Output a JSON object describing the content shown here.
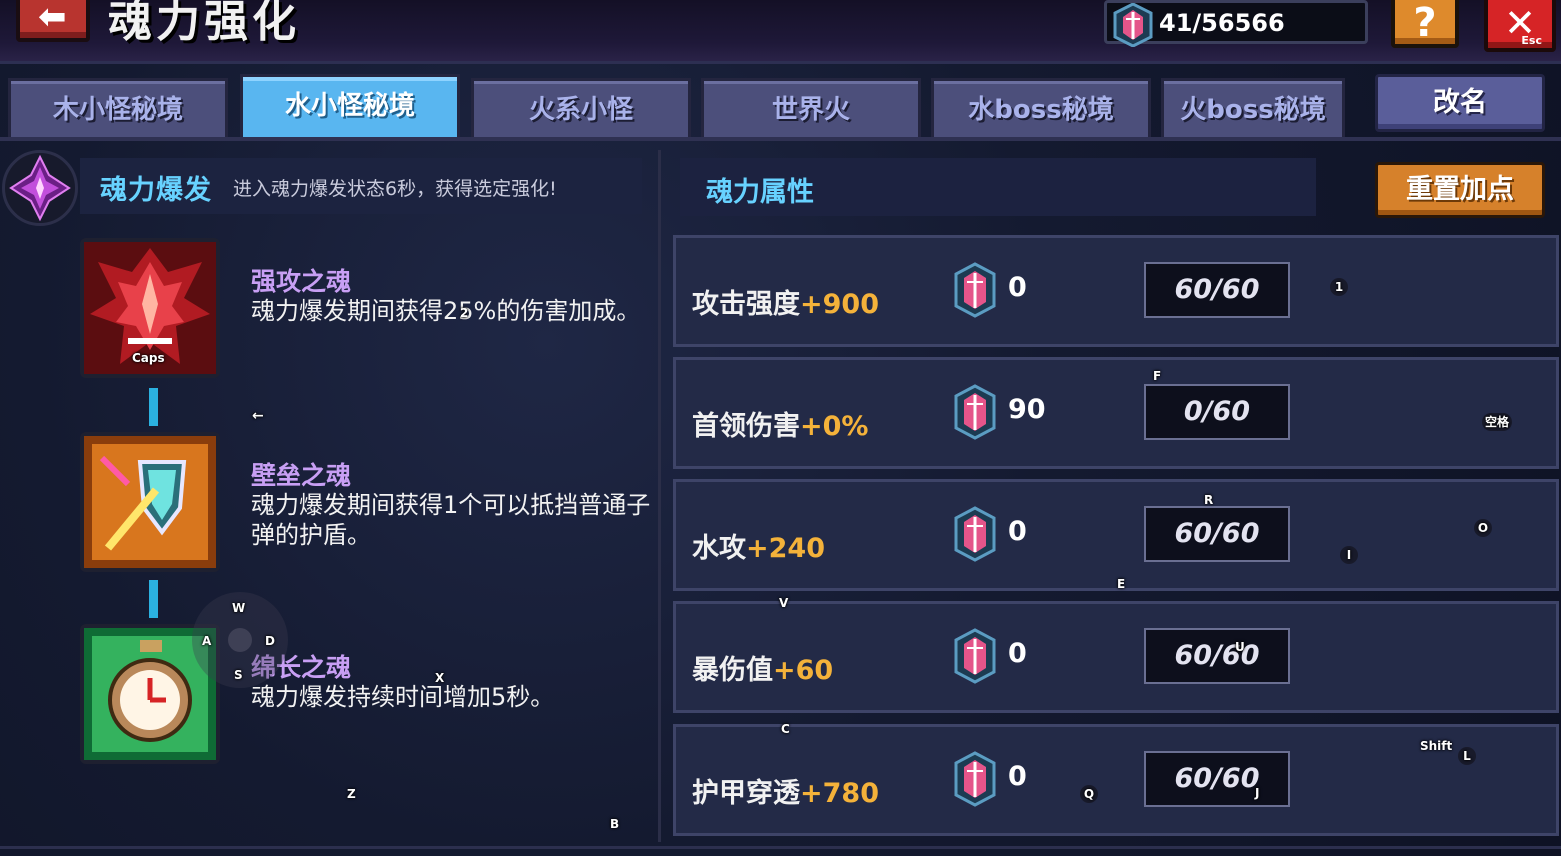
{
  "header": {
    "title": "魂力强化",
    "soul_count": "41/56566",
    "help_label": "?",
    "close_esc_label": "Esc"
  },
  "tabs": [
    {
      "label": "木小怪秘境",
      "active": false
    },
    {
      "label": "水小怪秘境",
      "active": true
    },
    {
      "label": "火系小怪",
      "active": false
    },
    {
      "label": "世界火",
      "active": false
    },
    {
      "label": "水boss秘境",
      "active": false
    },
    {
      "label": "火boss秘境",
      "active": false
    }
  ],
  "rename_label": "改名",
  "burst": {
    "title": "魂力爆发",
    "description": "进入魂力爆发状态6秒，获得选定强化!"
  },
  "skills": [
    {
      "name": "强攻之魂",
      "description": "魂力爆发期间获得25%的伤害加成。",
      "icon": "flame-crest-icon"
    },
    {
      "name": "壁垒之魂",
      "description": "魂力爆发期间获得1个可以抵挡普通子弹的护盾。",
      "icon": "shield-sword-icon"
    },
    {
      "name": "绵长之魂",
      "description": "魂力爆发持续时间增加5秒。",
      "icon": "stopwatch-icon"
    }
  ],
  "attributes": {
    "title": "魂力属性",
    "reset_label": "重置加点",
    "rows": [
      {
        "name": "攻击强度",
        "bonus": "+900",
        "cost": "0",
        "level": "60/60"
      },
      {
        "name": "首领伤害",
        "bonus": "+0%",
        "cost": "90",
        "level": "0/60"
      },
      {
        "name": "水攻",
        "bonus": "+240",
        "cost": "0",
        "level": "60/60"
      },
      {
        "name": "暴伤值",
        "bonus": "+60",
        "cost": "0",
        "level": "60/60"
      },
      {
        "name": "护甲穿透",
        "bonus": "+780",
        "cost": "0",
        "level": "60/60"
      }
    ]
  },
  "key_hints": {
    "caps": "Caps",
    "left_arrow": "←",
    "k2": "2",
    "k1": "1",
    "F": "F",
    "space": "空格",
    "R": "R",
    "O": "O",
    "I": "I",
    "E": "E",
    "V": "V",
    "W": "W",
    "A": "A",
    "D": "D",
    "S": "S",
    "X": "X",
    "U": "U",
    "C": "C",
    "shift": "Shift",
    "L": "L",
    "Q": "Q",
    "J": "J",
    "Z": "Z",
    "B": "B"
  },
  "colors": {
    "accent_cyan": "#67d2ff",
    "bonus_orange": "#f4b23a",
    "skill_name_purple": "#c89ff4",
    "active_tab": "#59b6f0"
  }
}
